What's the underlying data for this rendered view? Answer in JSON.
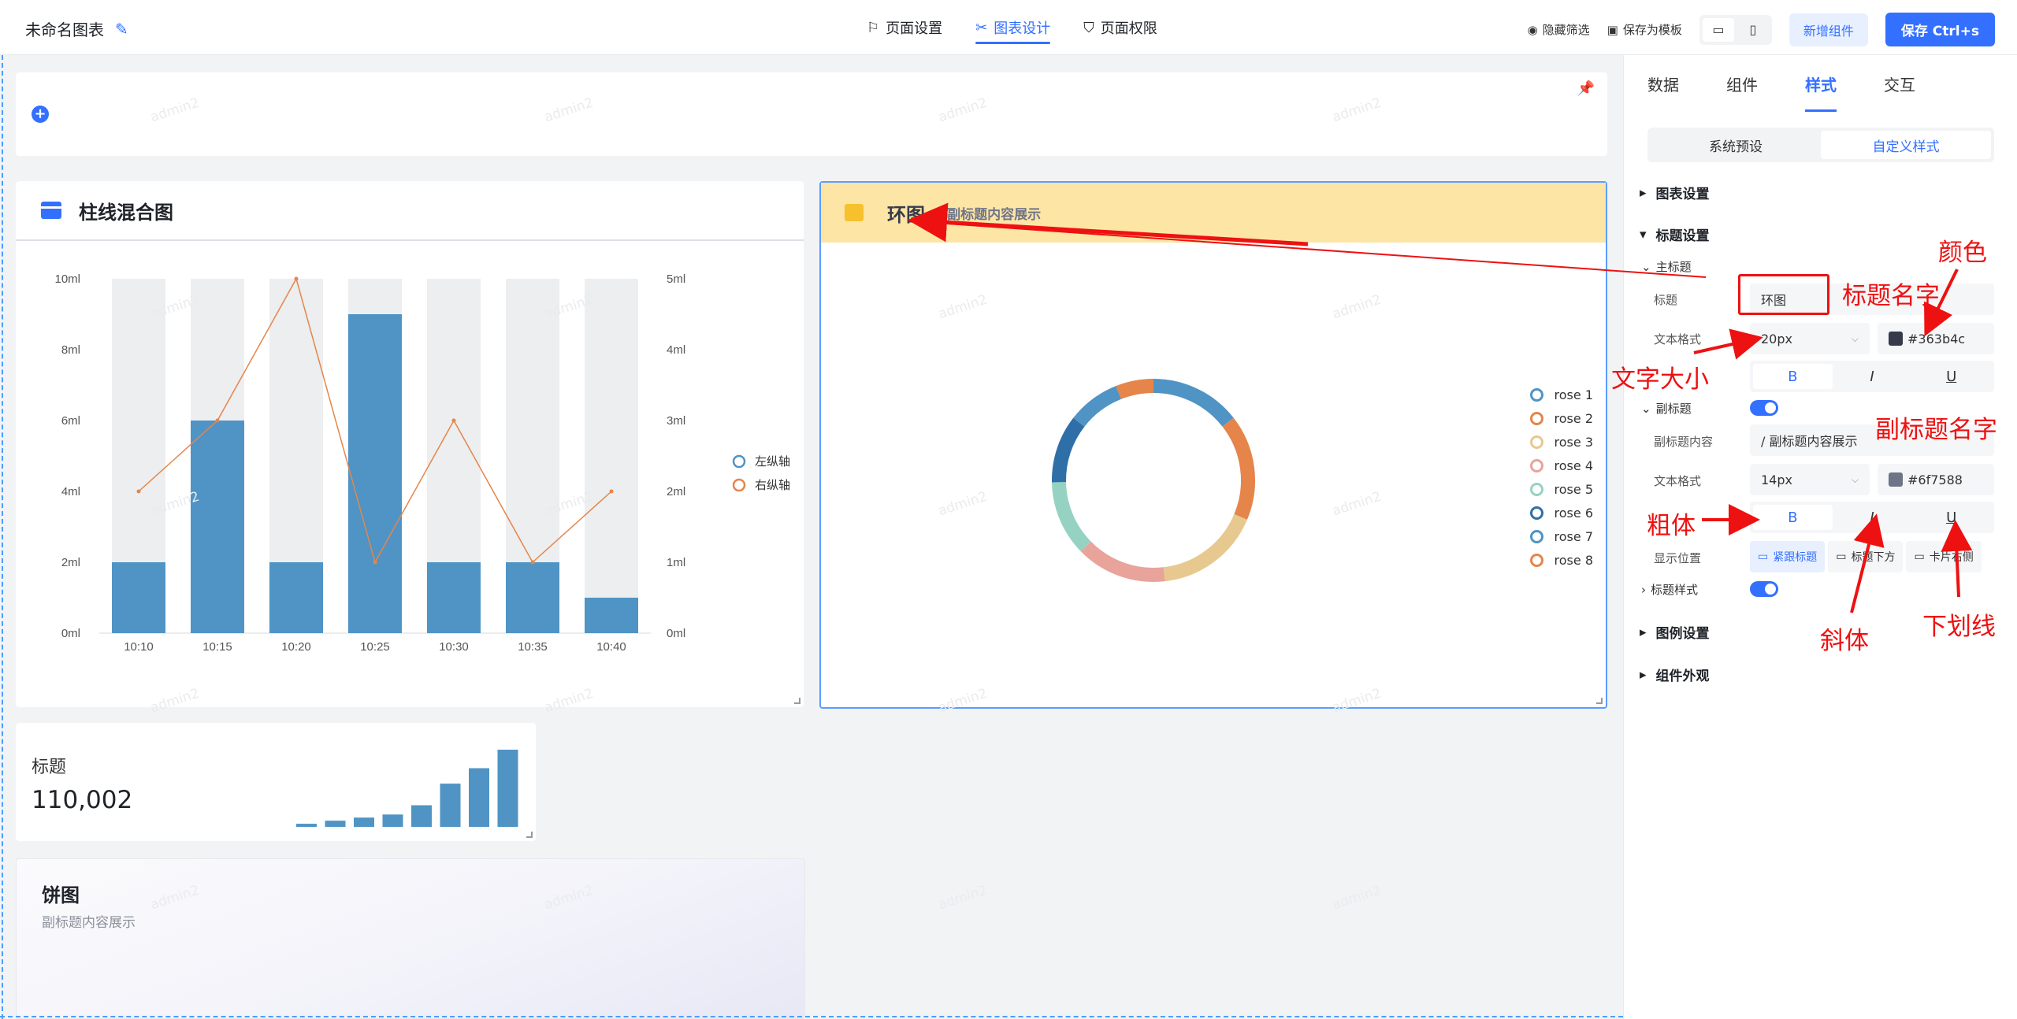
{
  "header": {
    "title": "未命名图表",
    "tabs": [
      {
        "label": "页面设置",
        "icon": "bookmark-icon"
      },
      {
        "label": "图表设计",
        "icon": "design-icon"
      },
      {
        "label": "页面权限",
        "icon": "shield-icon"
      }
    ],
    "active_tab": "图表设计",
    "hide_filter": "隐藏筛选",
    "save_template": "保存为模板",
    "add_component": "新增组件",
    "save": "保存 Ctrl+s"
  },
  "watermark": "admin2",
  "bar_card": {
    "title": "柱线混合图"
  },
  "chart_data": [
    {
      "type": "bar",
      "categories": [
        "10:10",
        "10:15",
        "10:20",
        "10:25",
        "10:30",
        "10:35",
        "10:40"
      ],
      "series": [
        {
          "name": "左纵轴",
          "type": "bar",
          "values": [
            2,
            6,
            2,
            9,
            2,
            2,
            1
          ],
          "color": "#4f94c5"
        },
        {
          "name": "右纵轴",
          "type": "line",
          "values": [
            2,
            3,
            5,
            1,
            3,
            1,
            2
          ],
          "color": "#e5854a"
        }
      ],
      "background_max": 10,
      "left_ticks": [
        "0ml",
        "2ml",
        "4ml",
        "6ml",
        "8ml",
        "10ml"
      ],
      "right_ticks": [
        "0ml",
        "1ml",
        "2ml",
        "3ml",
        "4ml",
        "5ml"
      ],
      "ylim": [
        0,
        10
      ],
      "y2lim": [
        0,
        5
      ],
      "legend": "right"
    },
    {
      "type": "pie",
      "donut": true,
      "categories": [
        "rose 1",
        "rose 2",
        "rose 3",
        "rose 4",
        "rose 5",
        "rose 6",
        "rose 7",
        "rose 8"
      ],
      "values": [
        12,
        14,
        14,
        12,
        10,
        9,
        7,
        5
      ],
      "colors": [
        "#4f94c5",
        "#e5854a",
        "#e7c98f",
        "#e8a39b",
        "#96d2c2",
        "#2f6fa7",
        "#4f94c5",
        "#e5854a"
      ],
      "legend": "right"
    },
    {
      "type": "bar",
      "values": [
        1,
        2,
        3,
        4,
        7,
        14,
        19,
        25
      ],
      "color": "#4f94c5"
    }
  ],
  "donut_card": {
    "title": "环图",
    "subtitle": "/ 副标题内容展示"
  },
  "kpi_card": {
    "title": "标题",
    "value": "110,002"
  },
  "pie_card": {
    "title": "饼图",
    "subtitle": "副标题内容展示"
  },
  "panel": {
    "tabs": [
      "数据",
      "组件",
      "样式",
      "交互"
    ],
    "active_tab": "样式",
    "segments": [
      "系统预设",
      "自定义样式"
    ],
    "sections": {
      "chart_settings": "图表设置",
      "title_settings": "标题设置",
      "legend_settings": "图例设置",
      "appearance": "组件外观"
    },
    "main_title": "主标题",
    "title_label": "标题",
    "title_value": "环图",
    "text_format_label": "文本格式",
    "title_size": "20px",
    "title_color": "#363b4c",
    "subtitle": "副标题",
    "subtitle_content_label": "副标题内容",
    "subtitle_content": "/ 副标题内容展示",
    "subtitle_size": "14px",
    "subtitle_color": "#6f7588",
    "bold": "B",
    "italic": "I",
    "underline": "U",
    "position_label": "显示位置",
    "positions": [
      "紧跟标题",
      "标题下方",
      "卡片右侧"
    ],
    "title_style": "标题样式"
  },
  "annotations": {
    "title_name": "标题名字",
    "color": "颜色",
    "font_size": "文字大小",
    "subtitle_name": "副标题名字",
    "bold": "粗体",
    "italic": "斜体",
    "underline": "下划线"
  }
}
